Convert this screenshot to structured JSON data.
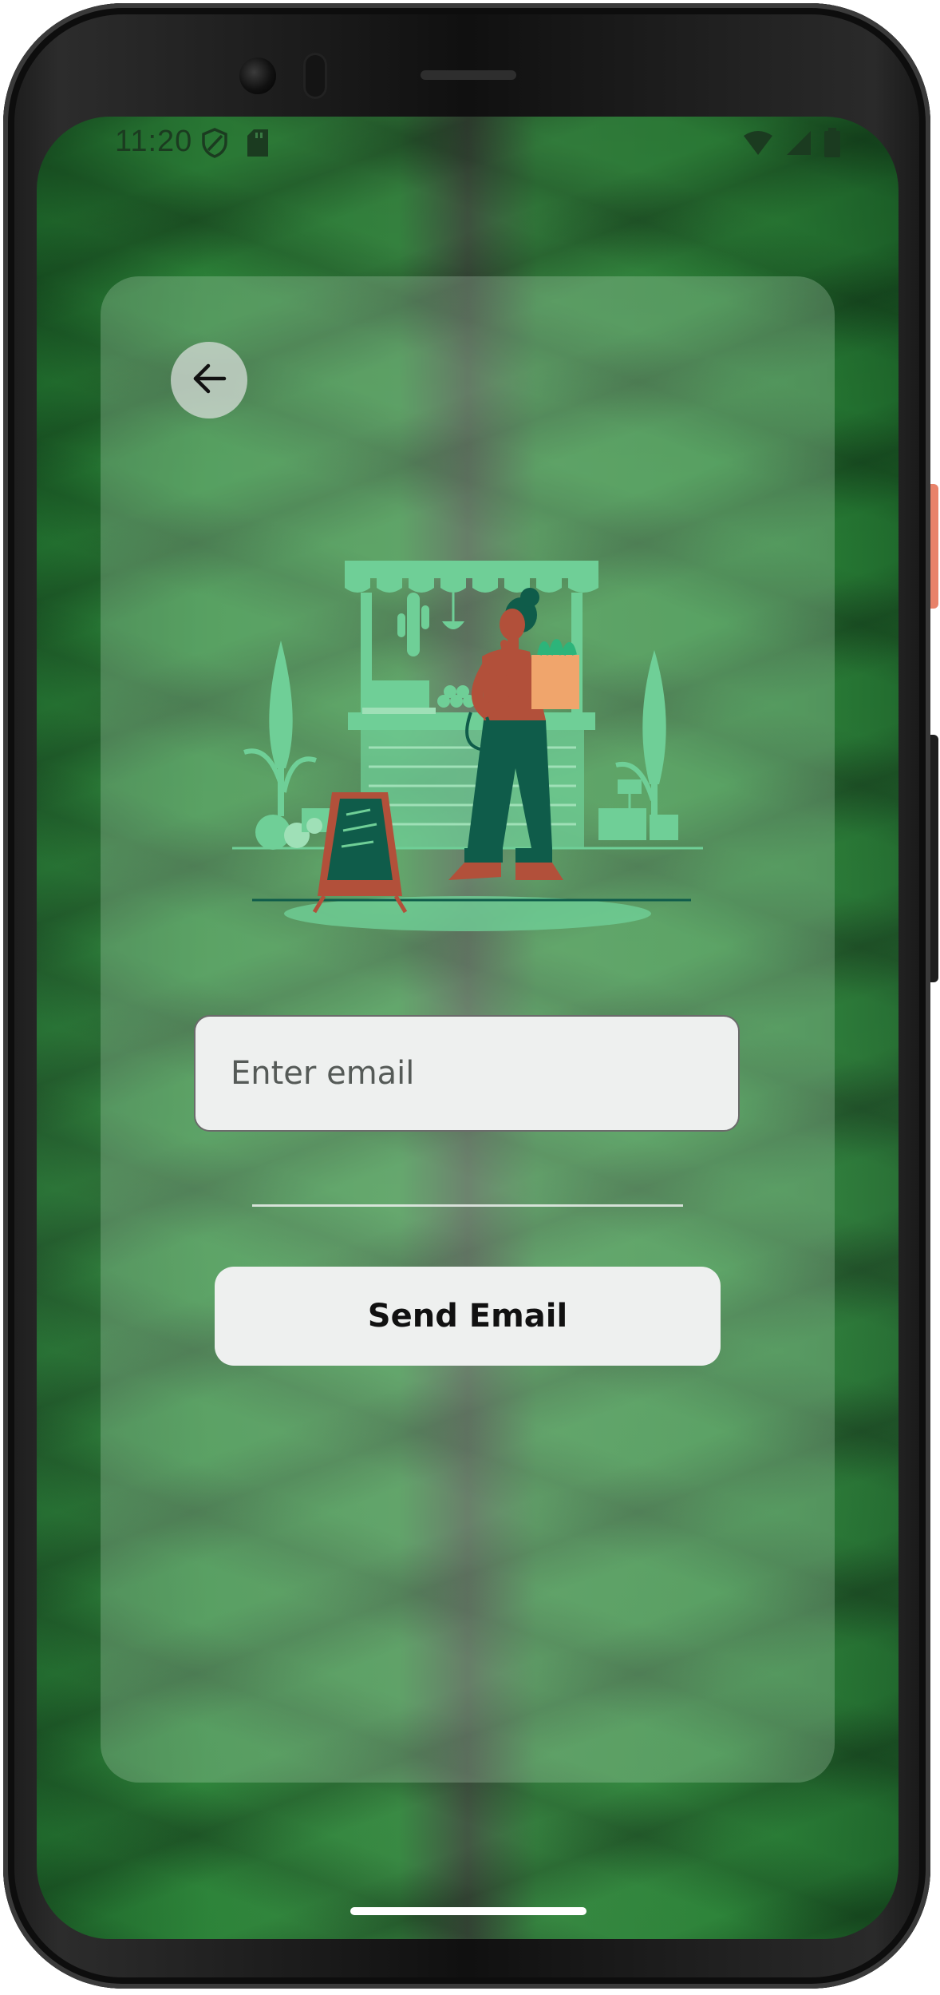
{
  "status_bar": {
    "time": "11:20",
    "left_icons": [
      "shield-icon",
      "sd-card-icon"
    ],
    "right_icons": [
      "wifi-icon",
      "cellular-signal-icon",
      "battery-icon"
    ]
  },
  "card": {
    "back_icon": "arrow-left-icon",
    "illustration": "market-stall-illustration",
    "email": {
      "value": "",
      "placeholder": "Enter email"
    },
    "send_button_label": "Send Email"
  },
  "colors": {
    "accent_green": "#6fcf97",
    "dark_green": "#0f5c4a",
    "card_bg": "rgba(190,220,195,0.28)",
    "button_bg": "#eef0ef"
  }
}
